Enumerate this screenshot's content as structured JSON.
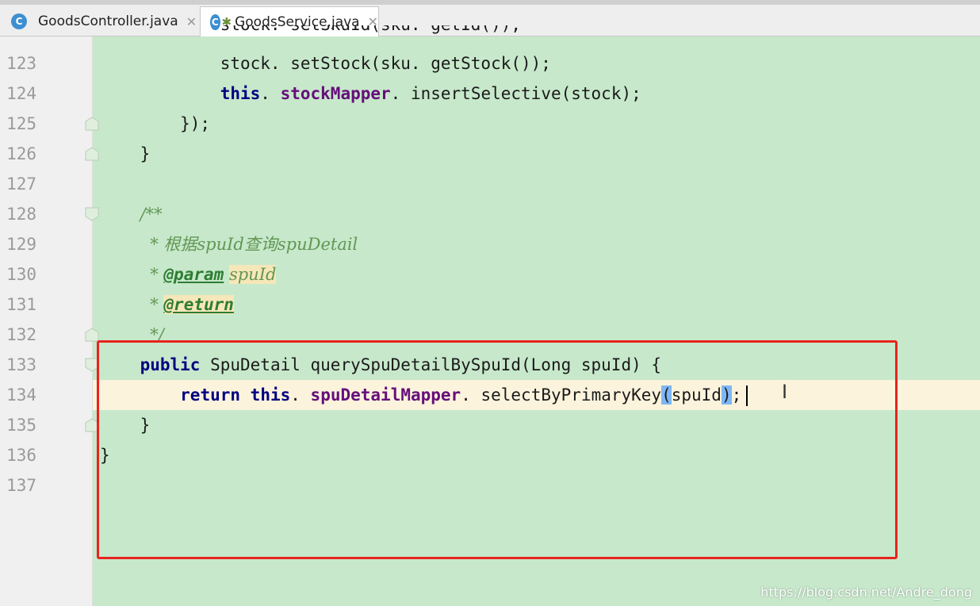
{
  "tabs": [
    {
      "label": "GoodsController.java",
      "icon": "C",
      "active": false
    },
    {
      "label": "GoodsService.java",
      "icon": "C",
      "active": true
    }
  ],
  "lines": [
    {
      "n": "123",
      "code": [
        {
          "t": "            stock. setStock(sku. getStock());"
        }
      ]
    },
    {
      "n": "124",
      "code": [
        {
          "t": "            "
        },
        {
          "t": "this",
          "c": "kw"
        },
        {
          "t": ". "
        },
        {
          "t": "stockMapper",
          "c": "field"
        },
        {
          "t": ". insertSelective(stock);"
        }
      ]
    },
    {
      "n": "125",
      "code": [
        {
          "t": "        });"
        }
      ]
    },
    {
      "n": "126",
      "code": [
        {
          "t": "    }"
        }
      ]
    },
    {
      "n": "127",
      "code": []
    },
    {
      "n": "128",
      "code": [
        {
          "t": "    "
        },
        {
          "t": "/**",
          "c": "cm"
        }
      ]
    },
    {
      "n": "129",
      "code": [
        {
          "t": "     "
        },
        {
          "t": "* 根据spuId查询spuDetail",
          "c": "cm"
        }
      ]
    },
    {
      "n": "130",
      "code": [
        {
          "t": "     "
        },
        {
          "t": "* ",
          "c": "cm"
        },
        {
          "t": "@param",
          "c": "tag"
        },
        {
          "t": " ",
          "c": "cm"
        },
        {
          "t": "spuId",
          "c": "cm hlword"
        }
      ]
    },
    {
      "n": "131",
      "code": [
        {
          "t": "     "
        },
        {
          "t": "* ",
          "c": "cm"
        },
        {
          "t": "@return",
          "c": "tag hlword"
        }
      ]
    },
    {
      "n": "132",
      "code": [
        {
          "t": "     "
        },
        {
          "t": "*/",
          "c": "cm"
        }
      ]
    },
    {
      "n": "133",
      "code": [
        {
          "t": "    "
        },
        {
          "t": "public",
          "c": "kw"
        },
        {
          "t": " SpuDetail querySpuDetailBySpuId(Long spuId) {"
        }
      ]
    },
    {
      "n": "134",
      "code": [
        {
          "t": "        "
        },
        {
          "t": "return",
          "c": "kw"
        },
        {
          "t": " "
        },
        {
          "t": "this",
          "c": "kw"
        },
        {
          "t": ". "
        },
        {
          "t": "spuDetailMapper",
          "c": "field"
        },
        {
          "t": ". selectByPrimaryKey"
        },
        {
          "t": "(",
          "c": "hlparen"
        },
        {
          "t": "spuId"
        },
        {
          "t": ")",
          "c": "hlparen"
        },
        {
          "t": ";"
        }
      ],
      "current": true
    },
    {
      "n": "135",
      "code": [
        {
          "t": "    }"
        }
      ]
    },
    {
      "n": "136",
      "code": [
        {
          "t": "}"
        }
      ]
    },
    {
      "n": "137",
      "code": []
    }
  ],
  "partial_line": "            stock. setSkuId(sku. getId());",
  "watermark": "https://blog.csdn.net/Andre_dong",
  "colors": {
    "editor_bg": "#c7e8cb",
    "highlight_box": "#e8231d"
  }
}
